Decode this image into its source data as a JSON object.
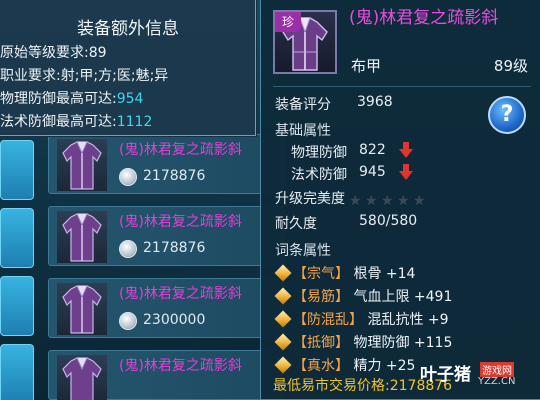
{
  "extra_info": {
    "title": "装备额外信息",
    "lines": [
      {
        "label": "原始等级要求:",
        "value": "89"
      },
      {
        "label": "职业要求:",
        "value": "射;甲;方;医;魅;异"
      },
      {
        "label": "物理防御最高可达:",
        "value": "954"
      },
      {
        "label": "法术防御最高可达:",
        "value": "1112"
      }
    ]
  },
  "market_list": {
    "rows": [
      {
        "name": "(鬼)林君复之疏影斜",
        "price": "2178876"
      },
      {
        "name": "(鬼)林君复之疏影斜",
        "price": "2178876"
      },
      {
        "name": "(鬼)林君复之疏影斜",
        "price": "2300000"
      },
      {
        "name": "(鬼)林君复之疏影斜",
        "price": ""
      }
    ]
  },
  "detail": {
    "rare_tag": "珍",
    "name": "(鬼)林君复之疏影斜",
    "type": "布甲",
    "level": "89级",
    "score_label": "装备评分",
    "score_value": "3968",
    "help_label": "?",
    "base_section": "基础属性",
    "phys_def_label": "物理防御",
    "phys_def_value": "822",
    "mag_def_label": "法术防御",
    "mag_def_value": "945",
    "upgrade_label": "升级完美度",
    "upgrade_stars": 0,
    "upgrade_stars_max": 5,
    "durability_label": "耐久度",
    "durability_value": "580/580",
    "affix_section": "词条属性",
    "affixes": [
      {
        "tag": "【宗气】",
        "text": "根骨 +14"
      },
      {
        "tag": "【易筋】",
        "text": "气血上限 +491"
      },
      {
        "tag": "【防混乱】",
        "text": "混乱抗性 +9"
      },
      {
        "tag": "【抵御】",
        "text": "物理防御 +115"
      },
      {
        "tag": "【真水】",
        "text": "精力 +25"
      }
    ],
    "min_price_label": "最低易市交易价格:",
    "min_price_value": "2178876"
  },
  "watermark": {
    "main": "叶子猪",
    "sub": "游戏网",
    "url": "YZZ.CN"
  },
  "colors": {
    "item_name": "#e94de0",
    "list_name": "#e040d6",
    "stat_max": "#3fd6f0",
    "affix_tag": "#f6a44a",
    "price": "#f1c232",
    "down_arrow": "#e0352f"
  }
}
